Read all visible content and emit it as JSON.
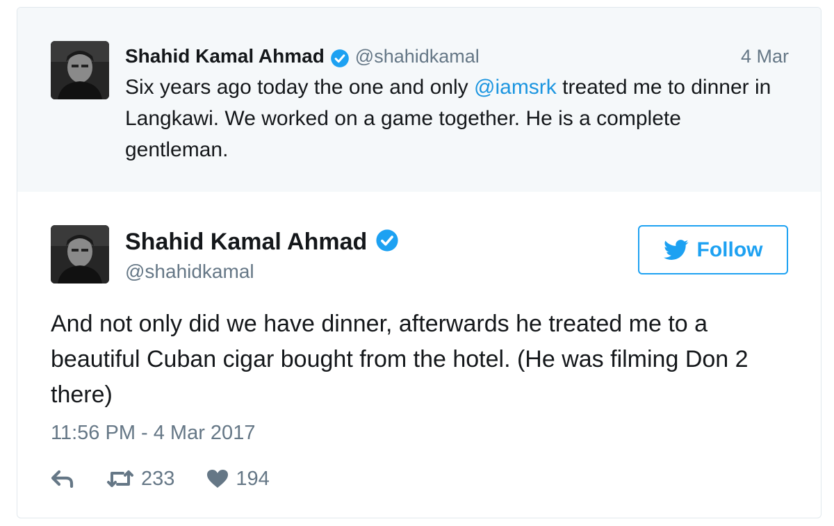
{
  "quoted_tweet": {
    "author_name": "Shahid Kamal Ahmad",
    "handle": "@shahidkamal",
    "date": "4 Mar",
    "text_before": "Six years ago today the one and only ",
    "mention": "@iamsrk",
    "text_after": " treated me to dinner in Langkawi. We worked on a game together. He is a complete gentleman."
  },
  "tweet": {
    "author_name": "Shahid Kamal Ahmad",
    "handle": "@shahidkamal",
    "follow_label": "Follow",
    "text": "And not only did we have dinner, afterwards he treated me to a beautiful Cuban cigar bought from the hotel. (He was filming Don 2 there)",
    "timestamp": "11:56 PM - 4 Mar 2017",
    "retweet_count": "233",
    "like_count": "194"
  },
  "icons": {
    "verified": "verified-badge-icon",
    "bird": "twitter-bird-icon",
    "reply": "reply-icon",
    "retweet": "retweet-icon",
    "like": "heart-icon"
  },
  "colors": {
    "accent": "#1da1f2",
    "mention": "#1b95e0",
    "secondary_text": "#657786",
    "quoted_background": "#f5f8fa",
    "border": "#e1e8ed"
  }
}
